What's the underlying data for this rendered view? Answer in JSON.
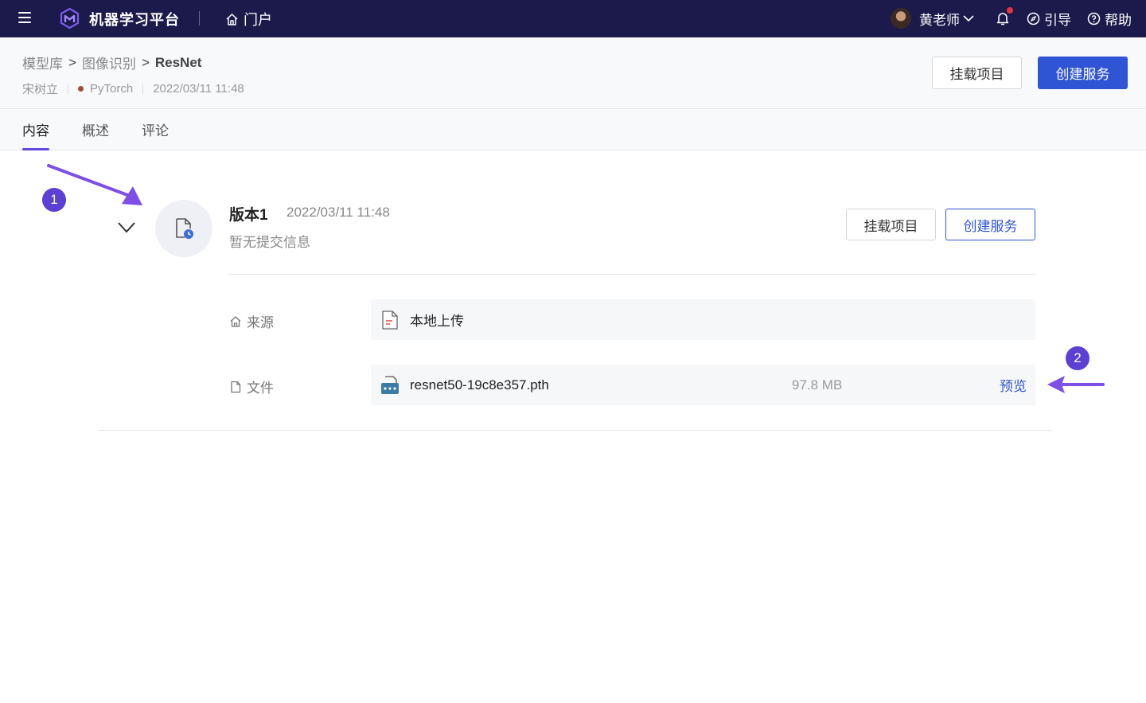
{
  "topbar": {
    "app_title": "机器学习平台",
    "portal_label": "门户",
    "user_name": "黄老师",
    "guide_label": "引导",
    "help_label": "帮助"
  },
  "header": {
    "breadcrumb": [
      "模型库",
      "图像识别",
      "ResNet"
    ],
    "breadcrumb_sep": ">",
    "author": "宋树立",
    "framework": "PyTorch",
    "framework_color": "#a54b38",
    "created_at": "2022/03/11 11:48",
    "mount_button": "挂载项目",
    "create_button": "创建服务"
  },
  "tabs": [
    {
      "label": "内容",
      "active": true
    },
    {
      "label": "概述",
      "active": false
    },
    {
      "label": "评论",
      "active": false
    }
  ],
  "version": {
    "title": "版本1",
    "date": "2022/03/11 11:48",
    "message": "暂无提交信息",
    "mount_button": "挂载项目",
    "create_button": "创建服务",
    "source": {
      "label": "来源",
      "value": "本地上传"
    },
    "file": {
      "label": "文件",
      "name": "resnet50-19c8e357.pth",
      "size": "97.8 MB",
      "action": "预览"
    }
  },
  "annotations": {
    "badge1": "1",
    "badge2": "2"
  },
  "colors": {
    "primary": "#2f55d4",
    "topbar": "#1c1a4b",
    "accent": "#6746e6",
    "badge": "#5c3fd4"
  }
}
